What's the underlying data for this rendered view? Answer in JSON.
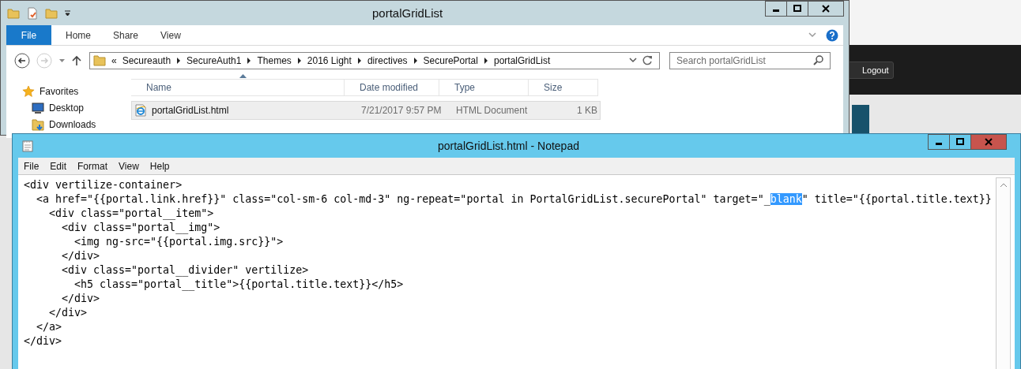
{
  "browser": {
    "logout_button": "Logout"
  },
  "explorer": {
    "title": "portalGridList",
    "ribbon_tabs": [
      {
        "label": "File",
        "kind": "file-menu"
      },
      {
        "label": "Home",
        "kind": "tab"
      },
      {
        "label": "Share",
        "kind": "tab"
      },
      {
        "label": "View",
        "kind": "tab"
      }
    ],
    "overflow_mark": "«",
    "breadcrumb": [
      "Secureauth",
      "SecureAuth1",
      "Themes",
      "2016 Light",
      "directives",
      "SecurePortal",
      "portalGridList"
    ],
    "search": {
      "placeholder": "Search portalGridList"
    },
    "nav": [
      {
        "label": "Favorites",
        "kind": "star"
      },
      {
        "label": "Desktop",
        "kind": "desktop"
      },
      {
        "label": "Downloads",
        "kind": "downloads"
      }
    ],
    "columns": [
      "Name",
      "Date modified",
      "Type",
      "Size"
    ],
    "files": [
      {
        "name": "portalGridList.html",
        "date": "7/21/2017 9:57 PM",
        "type": "HTML Document",
        "size": "1 KB",
        "selected": true
      }
    ]
  },
  "notepad": {
    "title": "portalGridList.html - Notepad",
    "menu": [
      "File",
      "Edit",
      "Format",
      "View",
      "Help"
    ],
    "lines": [
      [
        {
          "text": "<div vertilize-container>",
          "selected": false
        }
      ],
      [
        {
          "text": "  <a href=\"{{portal.link.href}}\" class=\"col-sm-6 col-md-3\" ng-repeat=\"portal in PortalGridList.securePortal\" target=\"_",
          "selected": false
        },
        {
          "text": "blank",
          "selected": true
        },
        {
          "text": "\" title=\"{{portal.title.text}}",
          "selected": false
        }
      ],
      [
        {
          "text": "    <div class=\"portal__item\">",
          "selected": false
        }
      ],
      [
        {
          "text": "      <div class=\"portal__img\">",
          "selected": false
        }
      ],
      [
        {
          "text": "        <img ng-src=\"{{portal.img.src}}\">",
          "selected": false
        }
      ],
      [
        {
          "text": "      </div>",
          "selected": false
        }
      ],
      [
        {
          "text": "      <div class=\"portal__divider\" vertilize>",
          "selected": false
        }
      ],
      [
        {
          "text": "        <h5 class=\"portal__title\">{{portal.title.text}}</h5>",
          "selected": false
        }
      ],
      [
        {
          "text": "      </div>",
          "selected": false
        }
      ],
      [
        {
          "text": "    </div>",
          "selected": false
        }
      ],
      [
        {
          "text": "  </a>",
          "selected": false
        }
      ],
      [
        {
          "text": "</div>",
          "selected": false
        }
      ]
    ]
  }
}
